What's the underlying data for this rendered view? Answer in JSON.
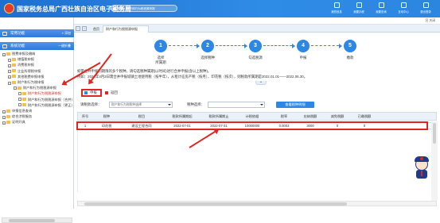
{
  "header": {
    "title": "国家税务总局广西壮族自治区电子税务局",
    "search_placeholder": "搜索：财产和行为税税源申报",
    "nav": [
      {
        "label": "我的信息",
        "icon": "user-icon"
      },
      {
        "label": "我要办税",
        "icon": "tax-icon"
      },
      {
        "label": "我要查询",
        "icon": "query-icon"
      },
      {
        "label": "互动中心",
        "icon": "chat-icon"
      },
      {
        "label": "退出登录",
        "icon": "logout-icon"
      }
    ]
  },
  "sidebar": {
    "common_label": "常用功能",
    "common_action": "» 添加",
    "system_label": "系统功能",
    "system_action": "一键折叠",
    "items": [
      {
        "label": "税费申报及缴纳",
        "level": 0,
        "red": false
      },
      {
        "label": "增值税申报",
        "level": 1,
        "red": false
      },
      {
        "label": "消费税申报",
        "level": 1,
        "red": false
      },
      {
        "label": "企业所得税申报",
        "level": 1,
        "red": false
      },
      {
        "label": "其他税费申报申报",
        "level": 1,
        "red": false
      },
      {
        "label": "财产和行为税申报",
        "level": 1,
        "red": false
      },
      {
        "label": "财产和行为税税源申报",
        "level": 2,
        "red": false
      },
      {
        "label": "财产和行为税税源申报",
        "level": 3,
        "red": true
      },
      {
        "label": "财产和行为税税源申报（合并）",
        "level": 3,
        "red": false
      },
      {
        "label": "财产和行为税税源申报（更正）",
        "level": 3,
        "red": false
      },
      {
        "label": "申报信息查询",
        "level": 0,
        "red": false
      },
      {
        "label": "综合涉税服务",
        "level": 0,
        "red": false
      },
      {
        "label": "证明开具",
        "level": 0,
        "red": false
      }
    ]
  },
  "toolbar": {
    "close_label": "⊠ 关闭"
  },
  "tabs": {
    "home": "首页",
    "active": "财产和行为税税源申报"
  },
  "steps": [
    {
      "num": "1",
      "label": "选择\n所属期"
    },
    {
      "num": "2",
      "label": "选择税种"
    },
    {
      "num": "3",
      "label": "勾选税源"
    },
    {
      "num": "4",
      "label": "申报"
    },
    {
      "num": "5",
      "label": "缴款"
    }
  ],
  "description": {
    "line1": "如需合并申报同期限的多个税种，请勾选税种属期(以时间)进行合并申报(含以上税种)。",
    "line2": "例如：2022年4月3日需合并申报城镇土地使用税（按半年），从租计征房产税（按月），印花税（按次），则税款所属期是2022.01.01——2022.06.30。"
  },
  "buttons": {
    "declare": "申报",
    "back": "返回",
    "query": "查看税种明细"
  },
  "filters": {
    "label1": "请税款选择：",
    "select1": "财产和行为税税种选择",
    "label2": "税种选择：",
    "select2": ""
  },
  "table": {
    "columns": [
      "序号",
      "税种",
      "税目",
      "税款所属期起",
      "税款所属期止",
      "计税依据",
      "税率",
      "应纳税额",
      "减免税额",
      "已缴税额"
    ],
    "rows": [
      [
        "1",
        "印花税",
        "建设工程合同",
        "2022-07-01",
        "2022-07-31",
        "10000000",
        "0.0003",
        "3000",
        "0",
        "0"
      ]
    ]
  },
  "colors": {
    "accent": "#2c87e5",
    "header": "#1d6fd0",
    "highlight": "#e0261f"
  }
}
